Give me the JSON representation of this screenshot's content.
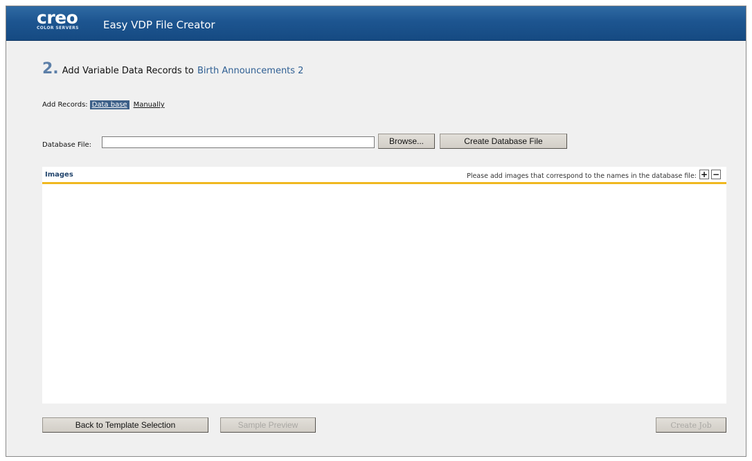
{
  "header": {
    "logo_text": "creo",
    "logo_subtext": "COLOR SERVERS",
    "app_title": "Easy VDP File Creator"
  },
  "heading": {
    "step_number": "2.",
    "text": "Add Variable Data Records to",
    "project_name": "Birth Announcements 2"
  },
  "add_records": {
    "label": "Add Records:",
    "options": [
      "Data base",
      "Manually"
    ],
    "selected": "Data base"
  },
  "database": {
    "label": "Database File:",
    "value": "",
    "browse_label": "Browse...",
    "create_label": "Create Database File"
  },
  "images": {
    "title": "Images",
    "hint": "Please add images that correspond to the names in the database file:",
    "add_label": "+",
    "remove_label": "−"
  },
  "footer": {
    "back_label": "Back to Template Selection",
    "preview_label": "Sample Preview",
    "create_job_label": "Create Job"
  },
  "colors": {
    "header_blue": "#1d5590",
    "accent_yellow": "#f0b820",
    "selected_tab": "#3c5f88",
    "project_name": "#2f5f93"
  }
}
